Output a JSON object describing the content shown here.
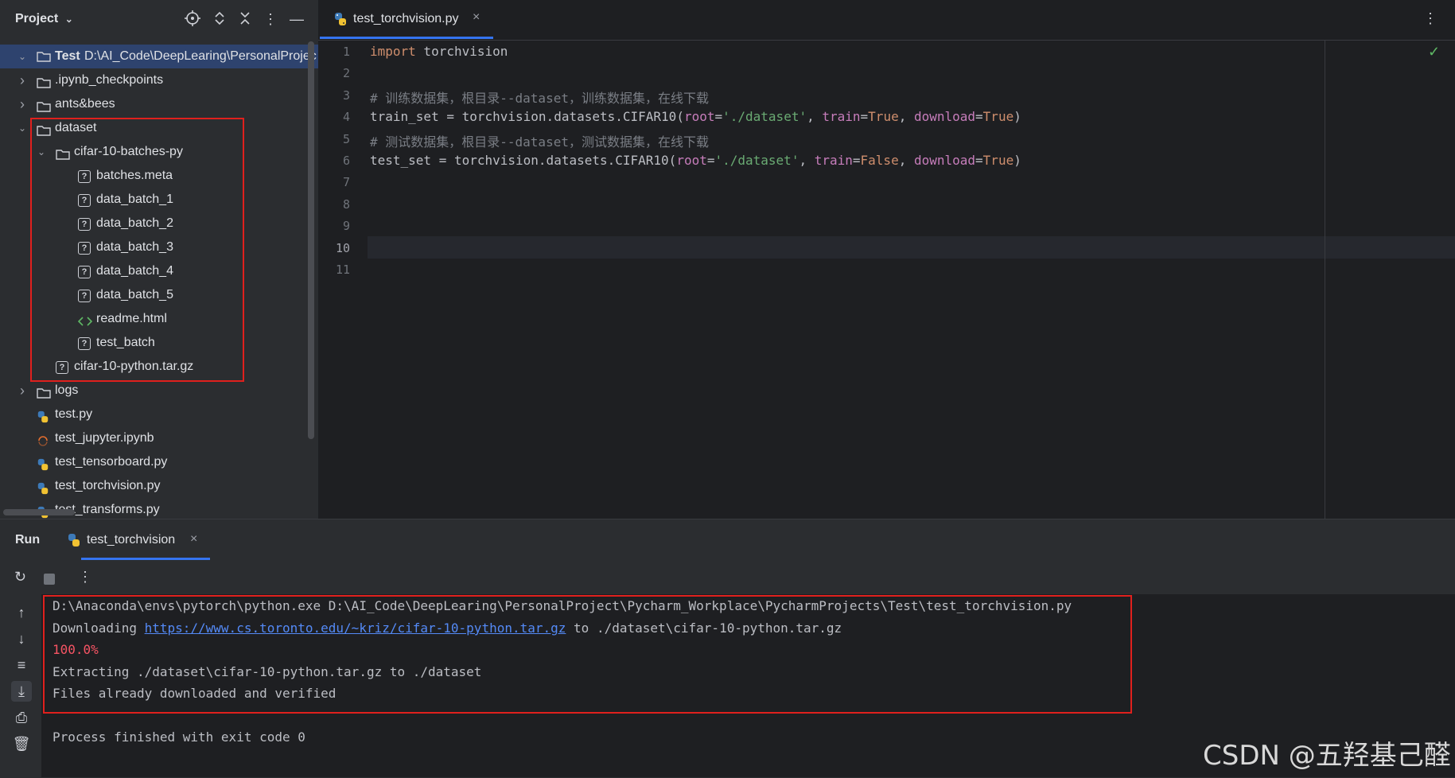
{
  "project_panel": {
    "title": "Project",
    "root": {
      "name": "Test",
      "path": "D:\\AI_Code\\DeepLearing\\PersonalProjec"
    },
    "items": [
      {
        "label": ".ipynb_checkpoints",
        "type": "folder"
      },
      {
        "label": "ants&bees",
        "type": "folder"
      },
      {
        "label": "dataset",
        "type": "folder"
      },
      {
        "label": "cifar-10-batches-py",
        "type": "folder"
      },
      {
        "label": "batches.meta",
        "type": "unknown-file"
      },
      {
        "label": "data_batch_1",
        "type": "unknown-file"
      },
      {
        "label": "data_batch_2",
        "type": "unknown-file"
      },
      {
        "label": "data_batch_3",
        "type": "unknown-file"
      },
      {
        "label": "data_batch_4",
        "type": "unknown-file"
      },
      {
        "label": "data_batch_5",
        "type": "unknown-file"
      },
      {
        "label": "readme.html",
        "type": "html-file"
      },
      {
        "label": "test_batch",
        "type": "unknown-file"
      },
      {
        "label": "cifar-10-python.tar.gz",
        "type": "unknown-file"
      },
      {
        "label": "logs",
        "type": "folder"
      },
      {
        "label": "test.py",
        "type": "python-file"
      },
      {
        "label": "test_jupyter.ipynb",
        "type": "notebook-file"
      },
      {
        "label": "test_tensorboard.py",
        "type": "python-file"
      },
      {
        "label": "test_torchvision.py",
        "type": "python-file"
      },
      {
        "label": "test_transforms.py",
        "type": "python-file"
      }
    ]
  },
  "editor": {
    "tab_label": "test_torchvision.py",
    "line_numbers": [
      "1",
      "2",
      "3",
      "4",
      "5",
      "6",
      "7",
      "8",
      "9",
      "10",
      "11"
    ],
    "current_line": "10",
    "code": {
      "l1_kw": "import",
      "l1_rest": " torchvision",
      "l3": "# 训练数据集，根目录--dataset，训练数据集，在线下载",
      "l4_a": "train_set = torchvision.datasets.CIFAR10(",
      "l4_p1": "root",
      "l4_s1": "'./dataset'",
      "l4_p2": "train",
      "l4_v2": "True",
      "l4_p3": "download",
      "l4_v3": "True",
      "l5": "# 测试数据集，根目录--dataset，测试数据集，在线下载",
      "l6_a": "test_set = torchvision.datasets.CIFAR10(",
      "l6_p1": "root",
      "l6_s1": "'./dataset'",
      "l6_p2": "train",
      "l6_v2": "False",
      "l6_p3": "download",
      "l6_v3": "True"
    }
  },
  "run_panel": {
    "title": "Run",
    "tab_label": "test_torchvision",
    "console": {
      "line1": "D:\\Anaconda\\envs\\pytorch\\python.exe D:\\AI_Code\\DeepLearing\\PersonalProject\\Pycharm_Workplace\\PycharmProjects\\Test\\test_torchvision.py",
      "line2_prefix": "Downloading ",
      "line2_link": "https://www.cs.toronto.edu/~kriz/cifar-10-python.tar.gz",
      "line2_suffix": " to ./dataset\\cifar-10-python.tar.gz",
      "line3": "100.0%",
      "line4": "Extracting ./dataset\\cifar-10-python.tar.gz to ./dataset",
      "line5": "Files already downloaded and verified",
      "line7": "Process finished with exit code 0"
    }
  },
  "watermark": "CSDN @五羟基己醛",
  "colors": {
    "highlight_box": "#e0201d",
    "keyword": "#cf8e6d",
    "string": "#6aab73",
    "comment": "#7a7e85",
    "param": "#c77dbb",
    "link": "#548af7",
    "error": "#f75464"
  }
}
